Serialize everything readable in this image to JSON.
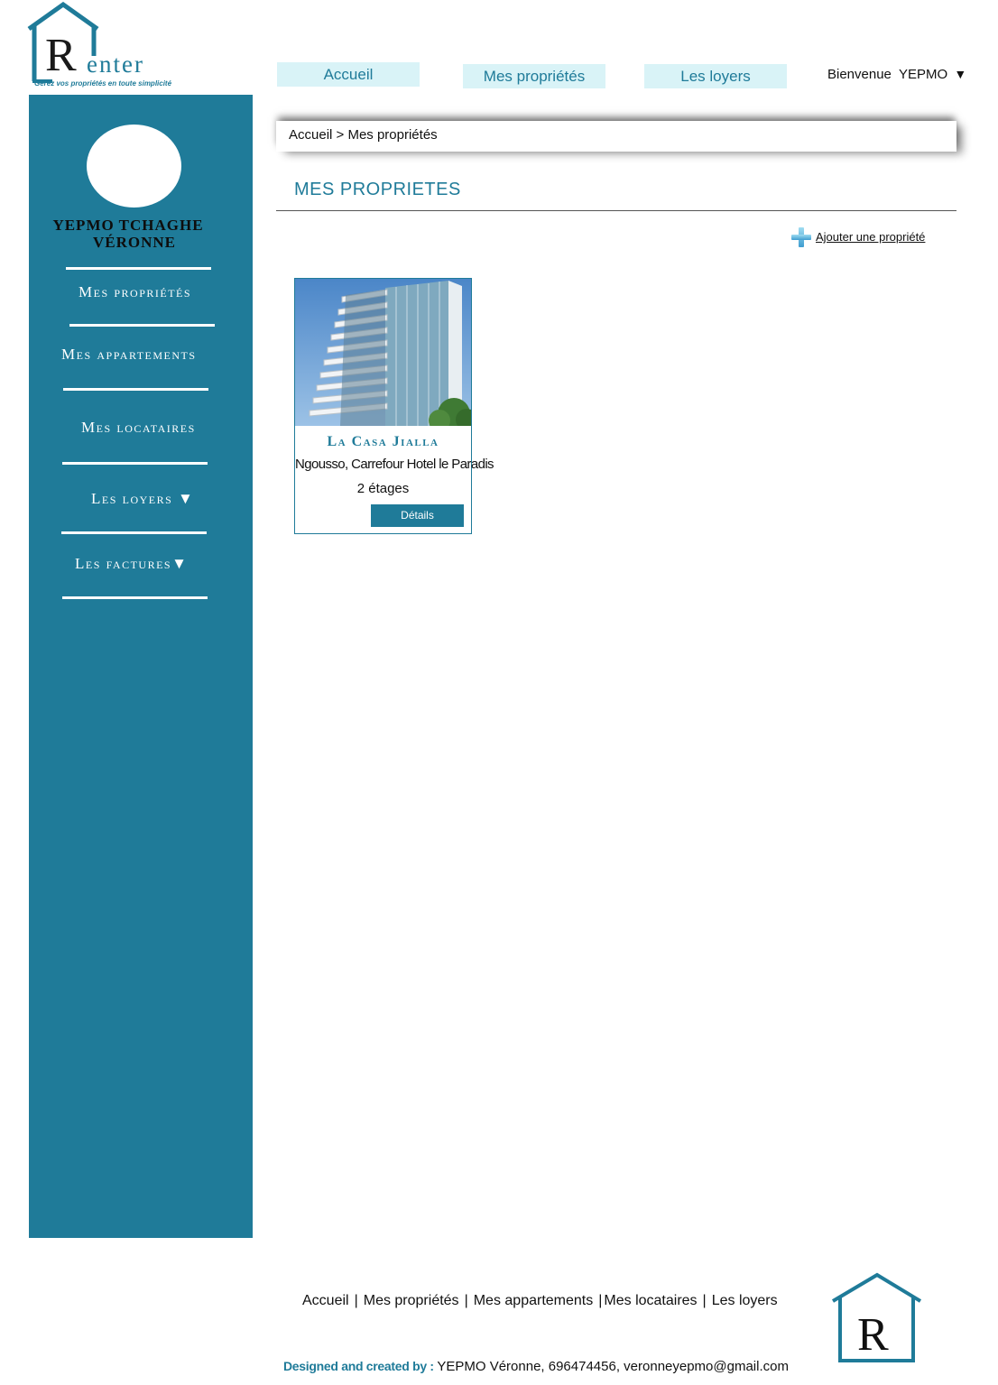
{
  "logo": {
    "letter": "R",
    "word": "enter",
    "tagline": "Gérez vos propriétés en toute simplicité"
  },
  "topnav": {
    "accueil": "Accueil",
    "proprietes": "Mes propriétés",
    "loyers": "Les loyers",
    "welcome": "Bienvenue  YEPMO",
    "welcome_arrow": "▼"
  },
  "sidebar": {
    "user_name_line1": "YEPMO TCHAGHE",
    "user_name_line2": "VÉRONNE",
    "items": [
      "Mes propriétés",
      "Mes appartements",
      "Mes locataires",
      "Les loyers ▼",
      "Les factures▼"
    ]
  },
  "breadcrumb": "Accueil > Mes propriétés",
  "page_title": "MES PROPRIETES",
  "add_property_label": "Ajouter une propriété",
  "properties": [
    {
      "name": "La Casa Jialla",
      "address": "Ngousso, Carrefour Hotel le Paradis",
      "floors": "2 étages",
      "details_label": "Détails"
    }
  ],
  "footer": {
    "links": [
      "Accueil",
      "Mes propriétés",
      "Mes appartements",
      "Mes locataires",
      "Les loyers"
    ],
    "credit_label": "Designed and created by : ",
    "credit_text": "YEPMO Véronne, 696474456, veronneyepmo@gmail.com",
    "logo_letter": "R"
  },
  "colors": {
    "primary": "#1f7b99",
    "nav_bg": "#d9f3f7"
  },
  "icons": {
    "add": "plus-icon",
    "logo": "house-icon",
    "dropdown": "caret-down-icon"
  }
}
